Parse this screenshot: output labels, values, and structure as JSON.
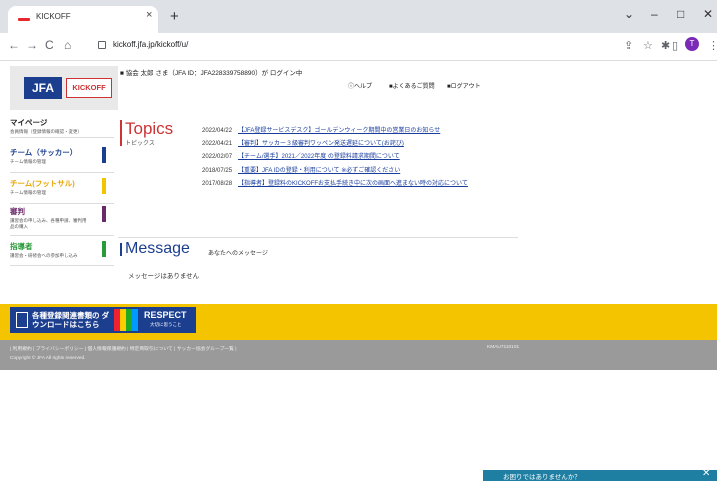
{
  "browser": {
    "tab_title": "KICKOFF",
    "tab_close": "×",
    "new_tab": "+",
    "win_chevron": "⌄",
    "win_min": "–",
    "win_max": "□",
    "win_close": "✕",
    "back": "←",
    "forward": "→",
    "reload": "C",
    "home": "⌂",
    "url": "kickoff.jfa.jp/kickoff/u/",
    "icons": [
      "share-icon",
      "star-icon",
      "extensions-icon",
      "sidebar-icon"
    ],
    "profile_initial": "T",
    "menu": "⋮"
  },
  "header": {
    "logo_jfa": "JFA",
    "logo_kickoff": "KICKOFF",
    "login_text": "協会 太郎 さま（JFA ID：JFA228339758890）が ログイン中",
    "links": [
      "ヘルプ",
      "よくあるご質問",
      "ログアウト"
    ]
  },
  "nav": [
    {
      "title": "マイページ",
      "sub": "会員情報（登録情報の確認・変更）",
      "color": ""
    },
    {
      "title": "チーム（サッカー）",
      "sub": "チーム情報の管理",
      "color": "#1b3e8f"
    },
    {
      "title": "チーム(フットサル)",
      "sub": "チーム情報の管理",
      "color": "#f5c400"
    },
    {
      "title": "審判",
      "sub": "講習会の申し込み、各種申請、審判用品の購入",
      "color": "#6b2a6b"
    },
    {
      "title": "指導者",
      "sub": "講習会・研修会への参加申し込み",
      "color": "#2a9a3a"
    }
  ],
  "topics": {
    "title": "Topics",
    "sub": "トピックス",
    "items": [
      {
        "date": "2022/04/22",
        "text": "【JFA登録サービスデスク】ゴールデンウィーク期間中の営業日のお知らせ"
      },
      {
        "date": "2022/04/21",
        "text": "【審判】サッカー３級審判ワッペン発送遅延について(お詫び)"
      },
      {
        "date": "2022/02/07",
        "text": "【チーム/選手】2021／2022年度 の登録料請求期間について"
      },
      {
        "date": "2018/07/25",
        "text": "【重要】JFA IDの登録・利用について ※必ずご確認ください"
      },
      {
        "date": "2017/08/28",
        "text": "【指導者】登録料のKICKOFFお支払手続き中に次の画面へ進まない時の対応について"
      }
    ]
  },
  "message": {
    "title": "Message",
    "sub": "あなたへのメッセージ",
    "empty": "メッセージはありません"
  },
  "banner": {
    "download_text": "各種登録関連書類の ダウンロードはこちら",
    "respect": "RESPECT",
    "respect_sub": "大切に思うこと"
  },
  "footer": {
    "links": "| 利用規約 | プライバシーポリシー | 個人情報保護規約 | 特定商取引について | サッカー協会グループ一覧 |",
    "copyright": "Copyright © JFA All rights reserved.",
    "id": "KMAU7110101"
  },
  "help": {
    "text": "お困りではありませんか？",
    "close": "✕"
  }
}
